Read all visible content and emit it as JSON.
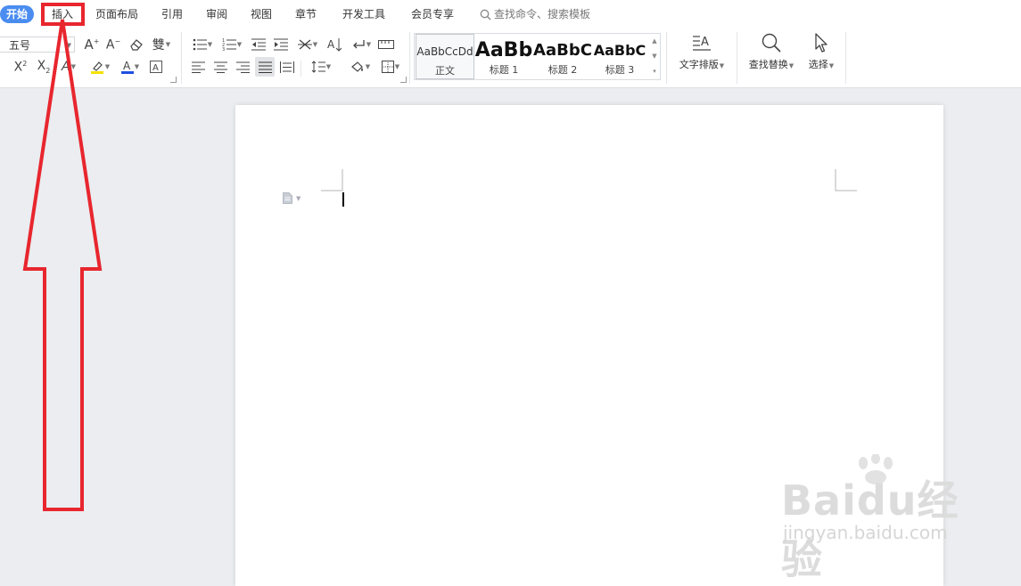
{
  "menu": {
    "tabs": [
      {
        "label": "开始",
        "active": true
      },
      {
        "label": "插入"
      },
      {
        "label": "页面布局"
      },
      {
        "label": "引用"
      },
      {
        "label": "审阅"
      },
      {
        "label": "视图"
      },
      {
        "label": "章节"
      },
      {
        "label": "开发工具"
      },
      {
        "label": "会员专享"
      }
    ],
    "search_label": "查找命令、搜索模板"
  },
  "ribbon": {
    "font_size": "五号",
    "styles": [
      {
        "preview": "AaBbCcDd",
        "label": "正文"
      },
      {
        "preview": "AaBb",
        "label": "标题 1"
      },
      {
        "preview": "AaBbC",
        "label": "标题 2"
      },
      {
        "preview": "AaBbC",
        "label": "标题 3"
      }
    ],
    "text_layout_label": "文字排版",
    "find_replace_label": "查找替换",
    "select_label": "选择"
  },
  "watermark": {
    "big": "Baidu经验",
    "small": "jingyan.baidu.com"
  },
  "colors": {
    "accent": "#4a8cf0",
    "annotation": "#e8262e",
    "highlight": "#f5e100",
    "font_color": "#e8262e"
  }
}
